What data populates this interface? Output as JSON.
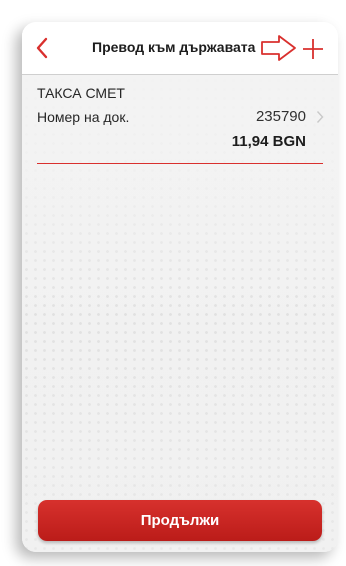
{
  "header": {
    "title": "Превод към държавата",
    "back_icon": "chevron-left-icon",
    "arrow_icon": "arrow-right-outline-icon",
    "add_icon": "plus-icon"
  },
  "payment": {
    "name": "ТАКСА СМЕТ",
    "doc_label": "Номер на док.",
    "doc_number": "235790",
    "amount": "11,94 BGN"
  },
  "actions": {
    "continue_label": "Продължи"
  },
  "colors": {
    "accent": "#d9302e",
    "button": "#c8221f",
    "background": "#f1f1f1"
  }
}
